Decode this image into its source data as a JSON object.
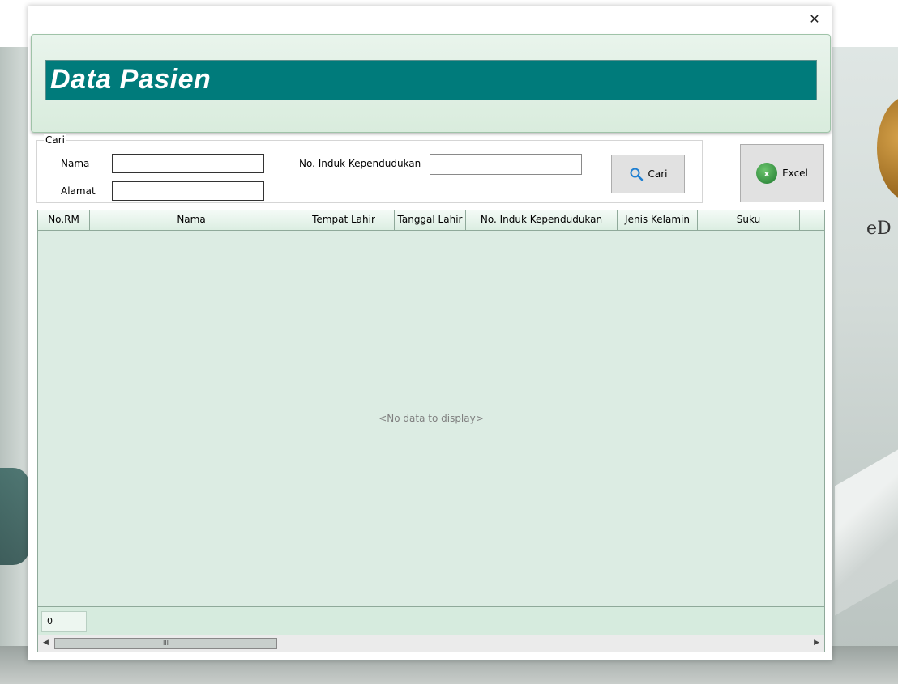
{
  "window": {
    "close_glyph": "✕"
  },
  "header": {
    "title": "Data Pasien"
  },
  "search": {
    "legend": "Cari",
    "nama_label": "Nama",
    "nama_value": "",
    "alamat_label": "Alamat",
    "alamat_value": "",
    "nik_label": "No. Induk Kependudukan",
    "nik_value": "",
    "cari_button": "Cari"
  },
  "toolbar": {
    "excel_button": "Excel",
    "excel_icon_text": "x"
  },
  "grid": {
    "columns": [
      "No.RM",
      "Nama",
      "Tempat Lahir",
      "Tanggal Lahir",
      "No. Induk Kependudukan",
      "Jenis Kelamin",
      "Suku",
      ""
    ],
    "empty_message": "<No data to display>",
    "row_count": "0",
    "scroll_thumb": "III"
  },
  "background": {
    "logo_text": "eD"
  },
  "colors": {
    "title_bg": "#007b7b",
    "grid_bg": "#dcece3",
    "header_panel": "#d9ecdd"
  }
}
